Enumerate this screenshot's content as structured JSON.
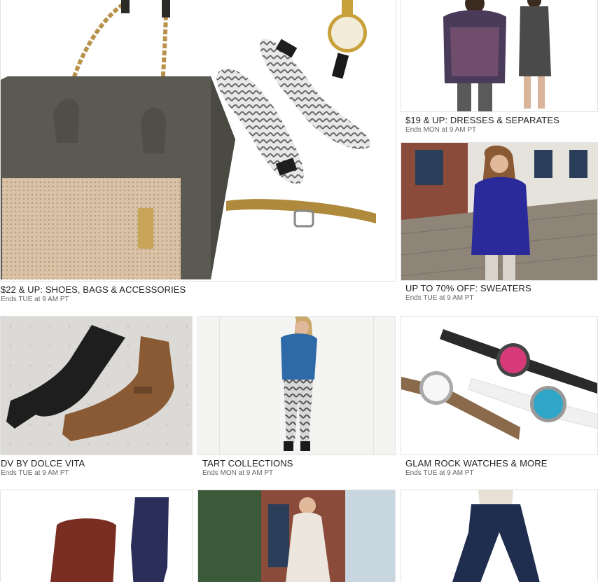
{
  "events": [
    {
      "title": "$22 & UP: SHOES, BAGS & ACCESSORIES",
      "ends": "Ends TUE at 9 AM PT"
    },
    {
      "title": "$19 & UP: DRESSES & SEPARATES",
      "ends": "Ends MON at 9 AM PT"
    },
    {
      "title": "UP TO 70% OFF: SWEATERS",
      "ends": "Ends TUE at 9 AM PT"
    },
    {
      "title": "DV BY DOLCE VITA",
      "ends": "Ends TUE at 9 AM PT"
    },
    {
      "title": "TART COLLECTIONS",
      "ends": "Ends MON at 9 AM PT"
    },
    {
      "title": "GLAM ROCK WATCHES & MORE",
      "ends": "Ends TUE at 9 AM PT"
    }
  ],
  "colors": {
    "bag": "#5a5a52",
    "bag_panel": "#d9c2a6",
    "chain": "#b8924a",
    "sweater": "#2a2a9a",
    "blouse": "#2e6aa8",
    "boot_black": "#1e1e1e",
    "boot_brown": "#8a5a34",
    "denim": "#1f2d4f",
    "watch_pink": "#d63a7a",
    "watch_blue": "#2fa6c8",
    "brick": "#8a4b3a"
  },
  "icons": [
    "handbag-image",
    "flats-image",
    "watch-image",
    "belt-image",
    "dress-model-image",
    "sweater-model-image",
    "boots-image",
    "tart-model-image",
    "watches-image",
    "ankle-boots-image",
    "maxi-dress-image",
    "jeans-model-image"
  ]
}
